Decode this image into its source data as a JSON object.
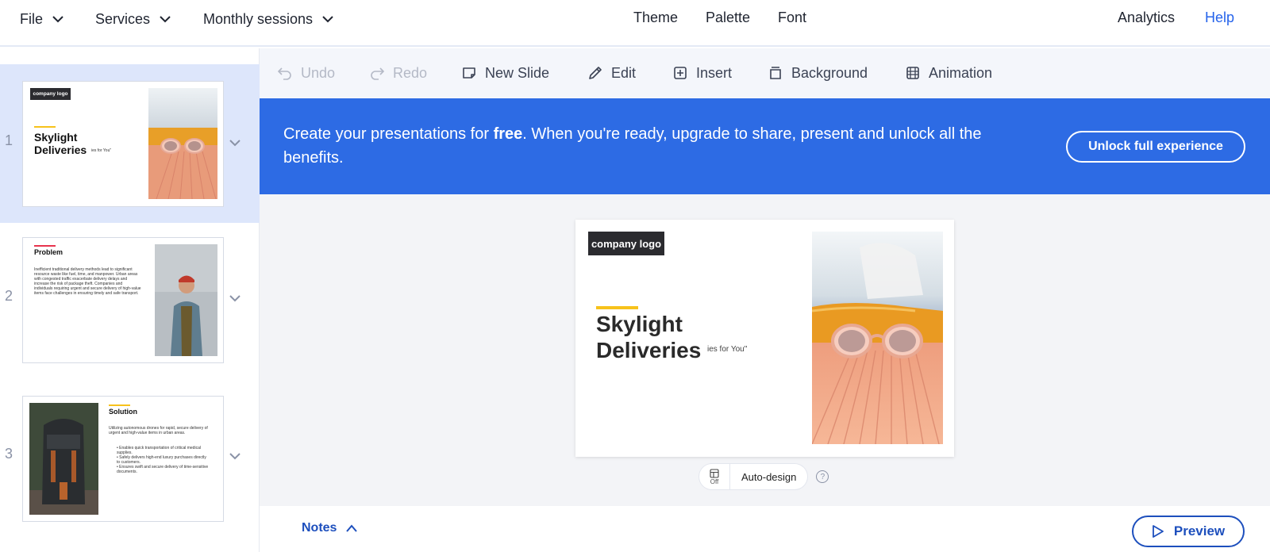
{
  "menu": {
    "file": "File",
    "services": "Services",
    "monthly": "Monthly sessions",
    "theme": "Theme",
    "palette": "Palette",
    "font": "Font",
    "analytics": "Analytics",
    "help": "Help"
  },
  "toolbar": {
    "undo": "Undo",
    "redo": "Redo",
    "new_slide": "New Slide",
    "edit": "Edit",
    "insert": "Insert",
    "background": "Background",
    "animation": "Animation"
  },
  "banner": {
    "text_before": "Create your presentations for ",
    "text_bold": "free",
    "text_after": ". When you're ready, upgrade to share, present and unlock all the benefits.",
    "button": "Unlock full experience"
  },
  "slides": [
    {
      "number": "1",
      "logo": "company logo",
      "title": "Skylight Deliveries",
      "subtitle": "ies for You\""
    },
    {
      "number": "2",
      "title": "Problem",
      "body": "Inefficient traditional delivery methods lead to significant resource waste like fuel, time, and manpower. Urban areas with congested traffic exacerbate delivery delays and increase the risk of package theft. Companies and individuals requiring urgent and secure delivery of high-value items face challenges in ensuring timely and safe transport."
    },
    {
      "number": "3",
      "title": "Solution",
      "body": "Utilizing autonomous drones for rapid, secure delivery of urgent and high-value items in urban areas.",
      "bullets": [
        "Enables quick transportation of critical medical supplies.",
        "Safely delivers high-end luxury purchases directly to customers.",
        "Ensures swift and secure delivery of time-sensitive documents."
      ]
    }
  ],
  "main_slide": {
    "logo": "company logo",
    "title": "Skylight Deliveries",
    "subtitle": "ies for You\""
  },
  "autodesign": {
    "state": "Off",
    "label": "Auto-design",
    "help": "?"
  },
  "bottom": {
    "notes": "Notes",
    "preview": "Preview"
  },
  "colors": {
    "accent_blue": "#2d6be4",
    "link_blue": "#1d4fbd",
    "accent_yellow": "#f7c21b"
  }
}
